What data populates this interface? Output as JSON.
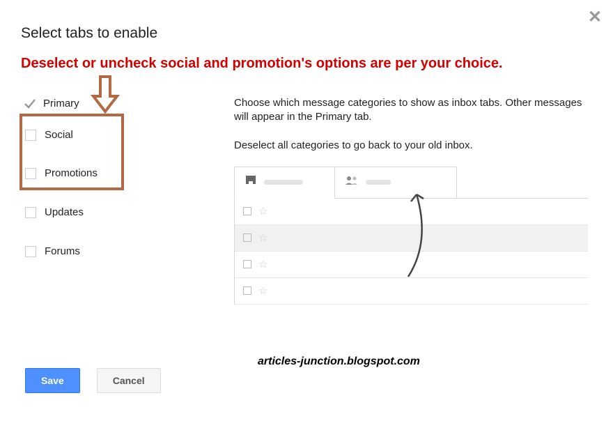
{
  "dialog": {
    "title": "Select tabs to enable",
    "annotation": "Deselect or uncheck social and promotion's options are per your choice.",
    "tabs": {
      "primary": "Primary",
      "social": "Social",
      "promotions": "Promotions",
      "updates": "Updates",
      "forums": "Forums"
    },
    "description_line1": "Choose which message categories to show as inbox tabs. Other messages will appear in the Primary tab.",
    "description_line2": "Deselect all categories to go back to your old inbox.",
    "buttons": {
      "save": "Save",
      "cancel": "Cancel"
    }
  },
  "watermark": "articles-junction.blogspot.com"
}
